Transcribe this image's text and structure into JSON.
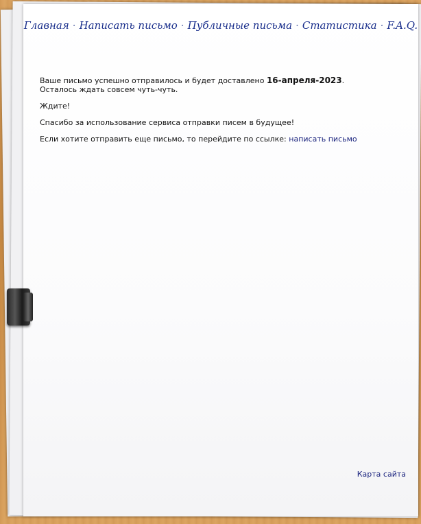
{
  "nav": {
    "items": [
      "Главная",
      "Написать письмо",
      "Публичные письма",
      "Статистика",
      "F.A.Q."
    ],
    "separator": "·"
  },
  "message": {
    "line1_prefix": "Ваше письмо успешно отправилось и будет доставлено",
    "delivery_date": "16-апреля-2023",
    "line1_suffix": ".",
    "line2": "Осталось ждать совсем чуть-чуть.",
    "wait": "Ждите!",
    "thanks": "Спасибо за использование сервиса отправки писем в будущее!",
    "more_prefix": "Если хотите отправить еще письмо, то перейдите по ссылке:",
    "more_link": "написать письмо"
  },
  "footer": {
    "sitemap": "Карта сайта"
  },
  "colors": {
    "nav": "#1a2f8c",
    "link": "#1a237e",
    "desk": "#c98b44",
    "paper": "#ffffff"
  }
}
